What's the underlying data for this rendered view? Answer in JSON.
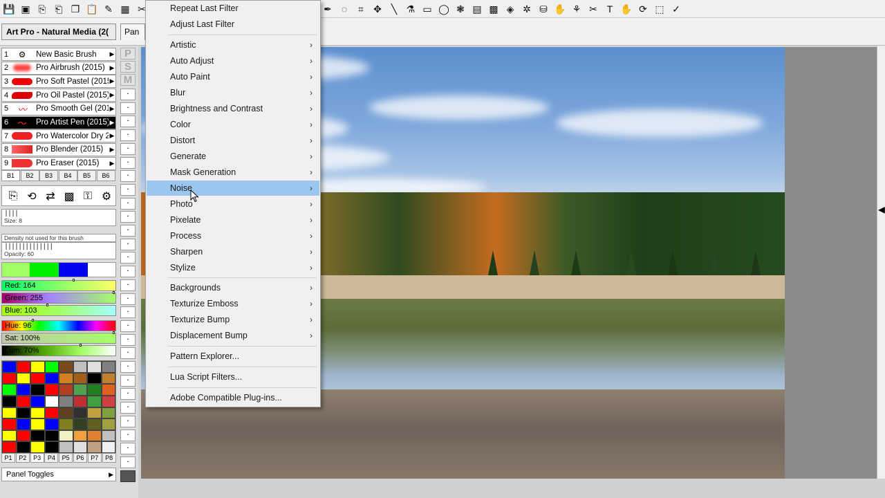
{
  "toolbar": {
    "left_icons": [
      "save-icon",
      "save-as-icon",
      "export-icon",
      "import-icon",
      "copy-icon",
      "paste-icon",
      "brush-edit-icon",
      "image-edit-icon",
      "tools-icon"
    ],
    "right_icons": [
      "pen-tool-icon",
      "lasso-icon",
      "crop-icon",
      "move-icon",
      "line-icon",
      "fill-icon",
      "rectangle-icon",
      "ellipse-icon",
      "blob-icon",
      "gradient-icon",
      "pattern-icon",
      "noise-icon",
      "texture-icon",
      "clone-icon",
      "smudge-icon",
      "retouch-icon",
      "picture-tube-icon",
      "text-icon",
      "hand-icon",
      "zoom-icon",
      "transform-icon",
      "eyedropper-icon"
    ]
  },
  "panel": {
    "title": "Art Pro - Natural Media (2(",
    "tab_label": "Pan",
    "brushes": [
      {
        "num": "1",
        "name": "New Basic Brush"
      },
      {
        "num": "2",
        "name": "Pro Airbrush (2015)"
      },
      {
        "num": "3",
        "name": "Pro Soft Pastel (2015"
      },
      {
        "num": "4",
        "name": "Pro Oil Pastel (2015)"
      },
      {
        "num": "5",
        "name": "Pro Smooth Gel (201"
      },
      {
        "num": "6",
        "name": "Pro Artist Pen (2015)"
      },
      {
        "num": "7",
        "name": "Pro Watercolor Dry 2"
      },
      {
        "num": "8",
        "name": "Pro Blender (2015)"
      },
      {
        "num": "9",
        "name": "Pro Eraser (2015)"
      }
    ],
    "psm": [
      "P",
      "S",
      "M"
    ],
    "brush_tabs": [
      "B1",
      "B2",
      "B3",
      "B4",
      "B5",
      "B6"
    ],
    "selected_brush_tab": "B1",
    "size_label": "Size: 8",
    "density_label": "Density not used for this brush",
    "opacity_label": "Opacity: 60",
    "colors": {
      "current": "#a4ff67",
      "secondary": "#00ee00",
      "tertiary": "#0000ee",
      "background": "#ffffff"
    },
    "sliders": {
      "red": "Red: 164",
      "green": "Green: 255",
      "blue": "Blue: 103",
      "hue": "Hue: 96",
      "sat": "Sat: 100%",
      "lum": "Lum: 70%"
    },
    "slider_values": {
      "red": 0.64,
      "green": 1.0,
      "blue": 0.4,
      "hue": 0.27,
      "sat": 1.0,
      "lum": 0.7
    },
    "palette_tabs": [
      "P1",
      "P2",
      "P3",
      "P4",
      "P5",
      "P6",
      "P7",
      "P8"
    ],
    "selected_palette_tab": "P3",
    "panel_toggles": "Panel Toggles"
  },
  "menu": {
    "items": [
      {
        "label": "Repeat Last Filter",
        "submenu": false
      },
      {
        "label": "Adjust Last Filter",
        "submenu": false
      },
      {
        "label": "Artistic",
        "submenu": true
      },
      {
        "label": "Auto Adjust",
        "submenu": true
      },
      {
        "label": "Auto Paint",
        "submenu": true
      },
      {
        "label": "Blur",
        "submenu": true
      },
      {
        "label": "Brightness and Contrast",
        "submenu": true
      },
      {
        "label": "Color",
        "submenu": true
      },
      {
        "label": "Distort",
        "submenu": true
      },
      {
        "label": "Generate",
        "submenu": true
      },
      {
        "label": "Mask Generation",
        "submenu": true
      },
      {
        "label": "Noise",
        "submenu": true
      },
      {
        "label": "Photo",
        "submenu": true
      },
      {
        "label": "Pixelate",
        "submenu": true
      },
      {
        "label": "Process",
        "submenu": true
      },
      {
        "label": "Sharpen",
        "submenu": true
      },
      {
        "label": "Stylize",
        "submenu": true
      },
      {
        "label": "Backgrounds",
        "submenu": true
      },
      {
        "label": "Texturize Emboss",
        "submenu": true
      },
      {
        "label": "Texturize Bump",
        "submenu": true
      },
      {
        "label": "Displacement Bump",
        "submenu": true
      },
      {
        "label": "Pattern Explorer...",
        "submenu": false
      },
      {
        "label": "Lua Script Filters...",
        "submenu": false
      },
      {
        "label": "Adobe Compatible Plug-ins...",
        "submenu": false
      }
    ],
    "highlighted": "Noise",
    "submenu_arrow": "›"
  }
}
